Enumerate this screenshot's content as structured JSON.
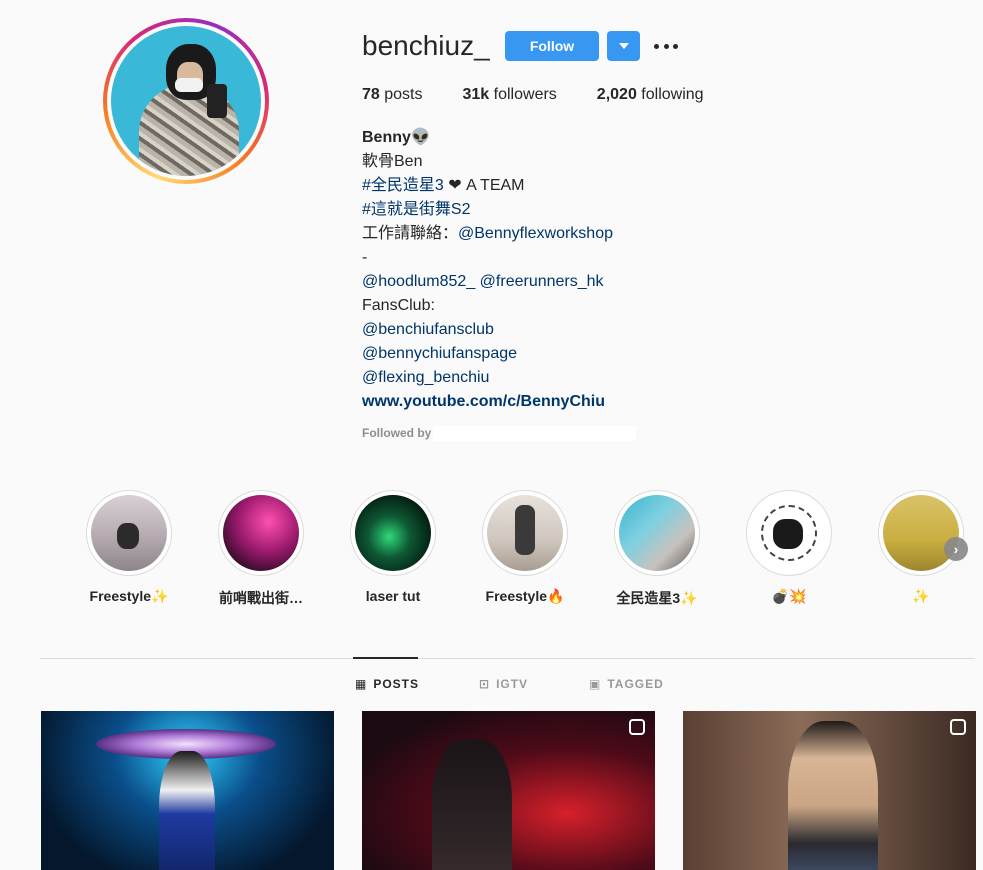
{
  "profile": {
    "username": "benchiuz_",
    "follow_label": "Follow",
    "stats": {
      "posts_value": "78",
      "posts_label": "posts",
      "followers_value": "31k",
      "followers_label": "followers",
      "following_value": "2,020",
      "following_label": "following"
    },
    "bio": {
      "name": "Benny👽",
      "lines": [
        "軟骨Ben",
        "#全民造星3",
        " ❤ A TEAM",
        "#這就是街舞S2",
        "工作請聯絡：",
        "@Bennyflexworkshop",
        "-",
        "@hoodlum852_",
        "@freerunners_hk",
        "FansClub:",
        "@benchiufansclub",
        "@bennychiufanspage",
        "@flexing_benchiu"
      ],
      "website": "www.youtube.com/c/BennyChiu",
      "followed_by": "Followed by"
    }
  },
  "highlights": [
    {
      "label": "Freestyle✨"
    },
    {
      "label": "前哨戰出街…"
    },
    {
      "label": "laser tut"
    },
    {
      "label": "Freestyle🔥"
    },
    {
      "label": "全民造星3✨"
    },
    {
      "label": "💣💥"
    },
    {
      "label": "✨"
    }
  ],
  "tabs": {
    "posts": "POSTS",
    "igtv": "IGTV",
    "tagged": "TAGGED"
  },
  "colors": {
    "accent": "#3897f0",
    "link": "#003569"
  }
}
